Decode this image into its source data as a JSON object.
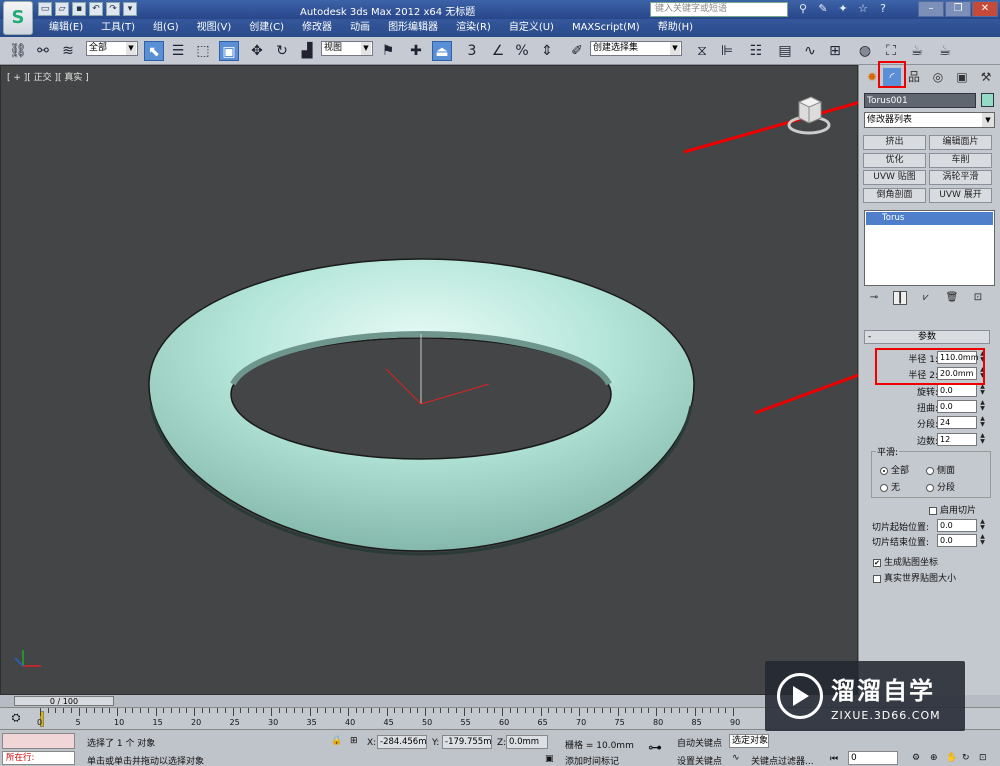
{
  "titlebar": {
    "app_title": "Autodesk 3ds Max  2012 x64     无标题",
    "search_placeholder": "键入关键字或短语",
    "help_label": "?"
  },
  "menubar": {
    "items": [
      "编辑(E)",
      "工具(T)",
      "组(G)",
      "视图(V)",
      "创建(C)",
      "修改器",
      "动画",
      "图形编辑器",
      "渲染(R)",
      "自定义(U)",
      "MAXScript(M)",
      "帮助(H)"
    ]
  },
  "toolbar": {
    "selection_filter": "全部",
    "ref_coord": "视图",
    "named_selection": "创建选择集",
    "snap_label": "3"
  },
  "viewport": {
    "label": "[ + ][ 正交 ][ 真实 ]",
    "object_color": "#a8e0d3"
  },
  "command_panel": {
    "object_name": "Torus001",
    "object_color": "#93dbc4",
    "modifier_list": "修改器列表",
    "modifier_buttons": [
      "挤出",
      "编辑面片",
      "优化",
      "车削",
      "UVW 贴图",
      "涡轮平滑",
      "倒角剖面",
      "UVW 展开"
    ],
    "stack_item": "Torus",
    "params_title": "参数",
    "params": [
      {
        "label": "半径 1:",
        "value": "110.0mm"
      },
      {
        "label": "半径 2:",
        "value": "20.0mm"
      },
      {
        "label": "旋转:",
        "value": "0.0"
      },
      {
        "label": "扭曲:",
        "value": "0.0"
      },
      {
        "label": "分段:",
        "value": "24"
      },
      {
        "label": "边数:",
        "value": "12"
      }
    ],
    "smooth_title": "平滑:",
    "smooth_options": [
      "全部",
      "侧面",
      "无",
      "分段"
    ],
    "slice_on_label": "启用切片",
    "slice_from_label": "切片起始位置:",
    "slice_from_value": "0.0",
    "slice_to_label": "切片结束位置:",
    "slice_to_value": "0.0",
    "gen_mapping_label": "生成贴图坐标",
    "real_world_label": "真实世界贴图大小"
  },
  "timeline": {
    "frame_display": "0 / 100",
    "ticks": [
      "0",
      "5",
      "10",
      "15",
      "20",
      "25",
      "30",
      "35",
      "40",
      "45",
      "50",
      "55",
      "60",
      "65",
      "70",
      "75",
      "80",
      "85",
      "90"
    ]
  },
  "statusbar": {
    "running_label": "所在行:",
    "selection_status": "选择了 1 个 对象",
    "prompt": "单击或单击并拖动以选择对象",
    "x_label": "X:",
    "x_value": "-284.456m",
    "y_label": "Y:",
    "y_value": "-179.755m",
    "z_label": "Z:",
    "z_value": "0.0mm",
    "grid": "栅格 = 10.0mm",
    "add_time_tag": "添加时间标记",
    "auto_key": "自动关键点",
    "set_key": "设置关键点",
    "selected_objects": "选定对象",
    "key_filters": "关键点过滤器...",
    "frame_value": "0"
  },
  "watermark": {
    "brand_cn": "溜溜自学",
    "brand_url": "ZIXUE.3D66.COM"
  },
  "colors": {
    "titlebar": "#2f549a",
    "viewport_bg": "#444546",
    "highlight_red": "#e00000",
    "stack_select": "#4f7ecb"
  }
}
